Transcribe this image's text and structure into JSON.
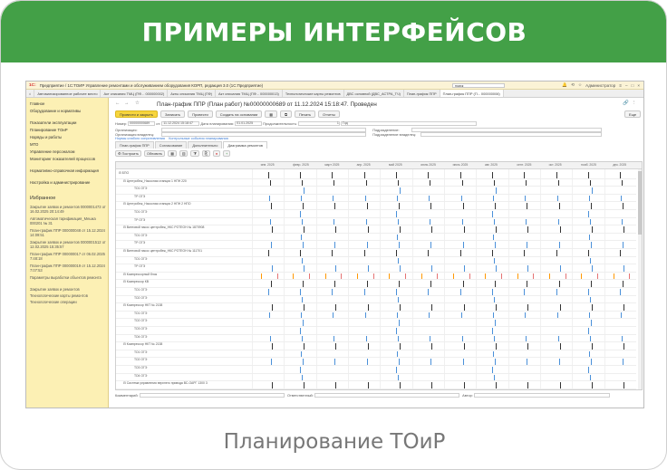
{
  "banner": {
    "title": "ПРИМЕРЫ ИНТЕРФЕЙСОВ"
  },
  "caption": "Планирование ТОиР",
  "app": {
    "title": "Предприятие / 1С:ТОИР Управление ремонтами и обслуживанием оборудования КОРП, редакция 3.0 (1С:Предприятие)",
    "search_value": "поиск",
    "user": "Администратор",
    "tabs": [
      "Автоматизированное рабочее место",
      "Акт списания ТМЦ (ПФ... 000000002)",
      "Акты списания ТМЦ (ПФ)",
      "Акт списания ТМЦ (ПФ... 000000013)",
      "Технологические карты ремонтов",
      "ДВС основной (ДВС_АСТРА_ТЧ)",
      "План-график ППР",
      "План-график ППР (П... 000000006)"
    ]
  },
  "sidebar": {
    "items": [
      "Главное",
      "Оборудование и нормативы",
      "Показатели эксплуатации",
      "Планирование ТОиР",
      "Наряды и работы",
      "МТО",
      "Управление персоналом",
      "Мониторинг показателей процессов",
      "Нормативно-справочная информация",
      "Настройка и администрирование"
    ],
    "favorites_title": "Избранное",
    "favorites": [
      "Закрытие заявок и ремонтов 0000001473 от 16.02.2025 20:14:49",
      "Автоматическая тарификация_Мешка 000201 № 31",
      "План-график ППР 000000048 от 15.12.2024 14:09:51",
      "Закрытие заявок и ремонтов 0000001512 от 12.02.2025 15:35:57",
      "План-график ППР 000000017 от 06.02.2025 7:48:18",
      "План-график ППР 000000019 от 15.12.2024 7:07:53",
      "Параметры выработки объектов ремонта",
      "Закрытие заявок и ремонтов",
      "Технологические карты ремонтов",
      "Технологические операции"
    ]
  },
  "document": {
    "title": "План-график ППР (План работ) №00000000689 от 11.12.2024 15:18:47. Проведен",
    "buttons": [
      "Провести и закрыть",
      "Записать",
      "Провести",
      "Создать на основании",
      "Печать",
      "Отчеты"
    ],
    "more_button": "Еще",
    "fields": {
      "number_label": "Номер:",
      "number_value": "00000000689",
      "date_label": "от:",
      "date_value": "11.12.2024 15:18:47",
      "plan_date_label": "Дата планирования:",
      "plan_date_value": "01.01.2025",
      "duration_label": "Продолжительность:",
      "duration_value": "1",
      "duration_unit": "Год",
      "org_label": "Организация:",
      "org_owner_label": "Организация владелец:",
      "dept_label": "Подразделение:",
      "dept_owner_label": "Подразделение владелец:"
    },
    "links": [
      "Нормы слабого сопротивления",
      "Контрольные события планирования"
    ],
    "subtabs": [
      "План-график ППР",
      "Согласование",
      "Дополнительно",
      "Диаграмма ремонтов"
    ],
    "grid_buttons": [
      "Построить",
      "Обновить"
    ],
    "comment_label": "Комментарий:",
    "responsible_label": "Ответственный:",
    "author_label": "Автор:"
  },
  "chart_data": {
    "type": "table",
    "columns": [
      "янв. 2025",
      "февр. 2025",
      "март 2025",
      "апр. 2025",
      "май 2025",
      "июнь 2025",
      "июль 2025",
      "авг. 2025",
      "сент. 2025",
      "окт. 2025",
      "нояб. 2025",
      "дек. 2025"
    ],
    "rows": [
      "БПО",
      "Центробеж_Насосная станция 1 НПН 220",
      "ТО1 ОГЭ",
      "ТР ОГЭ",
      "Центробеж_Насосная станция 2 НПН 2 НПО",
      "ТО1 ОГЭ",
      "ТР ОГЭ",
      "Винтовой насос центробеж_НКС РОТЕОН № 1870908",
      "ТО1 ОГЭ",
      "ТР ОГЭ",
      "Винтовой насос центробеж_НКС РОТЕОН № 111701",
      "ТО1 ОГЭ",
      "ТР ОГЭ",
      "Компрессорный блок",
      "Компрессор КВ",
      "ТО1 ОГЭ",
      "ТО2 ОГЭ",
      "Компрессор НКТ № 2138",
      "ТО1 ОГЭ",
      "ТО2 ОГЭ",
      "ТО3 ОГЭ",
      "ТО4 ОГЭ",
      "Компрессор НКТ № 2138",
      "ТО1 ОГЭ",
      "ТО2 ОГЭ",
      "ТО3 ОГЭ",
      "ТО4 ОГЭ",
      "Система управления верхнего привода ВС-ОАРГ 1300 3"
    ]
  }
}
